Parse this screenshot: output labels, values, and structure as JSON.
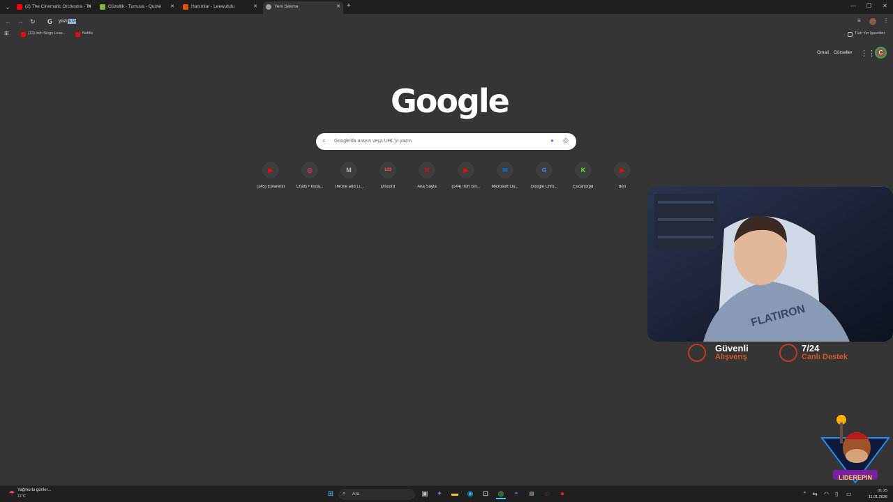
{
  "tabs": [
    {
      "title": "(2) The Cinematic Orchestra - To",
      "icon": "youtube-icon",
      "color": "#ff0000"
    },
    {
      "title": "Güzellik - Tumuva - Quizei",
      "icon": "quiz-icon",
      "color": "#7cb342"
    },
    {
      "title": "Hanımlar - Leewufufu",
      "icon": "site-icon",
      "color": "#e65100"
    },
    {
      "title": "Yeni Sekme",
      "icon": "chrome-icon",
      "color": "#9e9e9e"
    }
  ],
  "omnibox": {
    "typed": "yazı",
    "autocomplete": "tura"
  },
  "bookmarks": [
    {
      "label": "(13) Iroh Sings Leav...",
      "color": "#ff0000"
    },
    {
      "label": "Netflix",
      "color": "#e50914"
    }
  ],
  "bookmarks_right": "Tüm Yer İşaretleri",
  "header_links": {
    "gmail": "Gmail",
    "images": "Görseller"
  },
  "avatar_letter": "C",
  "logo": "Google",
  "search_placeholder": "Google'da arayın veya URL'yi yazın",
  "shortcuts": [
    {
      "label": "(145) Ebrarenn",
      "glyph": "▶",
      "color": "#ff0000"
    },
    {
      "label": "Chats • Insta...",
      "glyph": "◎",
      "color": "#e1306c"
    },
    {
      "label": "Throne and Li...",
      "glyph": "M",
      "color": "#bdbdbd"
    },
    {
      "label": "Discord",
      "glyph": "103",
      "color": "#ff5252"
    },
    {
      "label": "Ana Sayfa",
      "glyph": "N",
      "color": "#e50914"
    },
    {
      "label": "(144) Iroh Sin...",
      "glyph": "▶",
      "color": "#ff0000"
    },
    {
      "label": "Microsoft Ou...",
      "glyph": "✉",
      "color": "#0078d4"
    },
    {
      "label": "Google Chro...",
      "glyph": "G",
      "color": "#4285f4"
    },
    {
      "label": "Escanorpd",
      "glyph": "K",
      "color": "#53fc18"
    },
    {
      "label": "Ben",
      "glyph": "▶",
      "color": "#ff0000"
    }
  ],
  "overlay": {
    "safe_title": "Güvenli",
    "safe_sub": "Alışveriş",
    "support_title": "7/24",
    "support_sub": "Canlı Destek",
    "brand": "LIDEREPIN"
  },
  "taskbar": {
    "weather": "Yağmurlu günler...",
    "temp": "11°C",
    "search_label": "Ara",
    "time": "01:25",
    "date": "11.01.2026"
  }
}
